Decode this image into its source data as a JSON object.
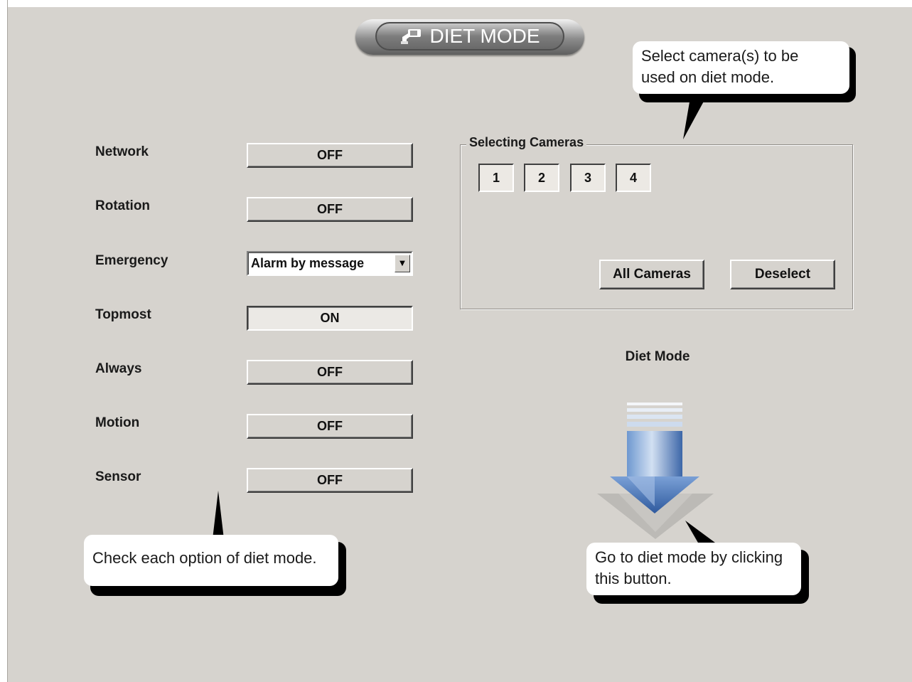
{
  "window": {
    "title": "DIET MODE"
  },
  "options": [
    {
      "label": "Network",
      "value": "OFF"
    },
    {
      "label": "Rotation",
      "value": "OFF"
    },
    {
      "label": "Emergency",
      "value": "Alarm by message"
    },
    {
      "label": "Topmost",
      "value": "ON"
    },
    {
      "label": "Always",
      "value": "OFF"
    },
    {
      "label": "Motion",
      "value": "OFF"
    },
    {
      "label": "Sensor",
      "value": "OFF"
    }
  ],
  "cameras": {
    "group_title": "Selecting Cameras",
    "items": [
      "1",
      "2",
      "3",
      "4"
    ],
    "all_label": "All Cameras",
    "deselect_label": "Deselect"
  },
  "diet_mode": {
    "label": "Diet Mode",
    "icon": "down-arrow-icon"
  },
  "callouts": {
    "cameras_line1": "Select camera(s) to be",
    "cameras_line2": "used on diet mode.",
    "options": "Check each option of diet mode.",
    "go_line1": "Go to diet mode by clicking",
    "go_line2": "this button."
  },
  "colors": {
    "background": "#d6d3ce",
    "arrow": "#4a78b8",
    "callout": "#ffffff"
  }
}
